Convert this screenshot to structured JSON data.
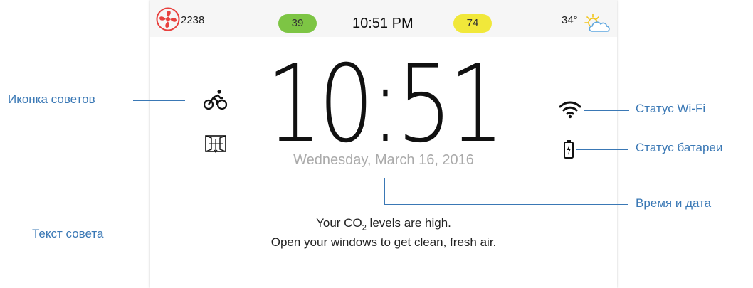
{
  "statusbar": {
    "fan_count": "2238",
    "green_badge": "39",
    "time": "10:51 PM",
    "yellow_badge": "74",
    "temperature": "34°",
    "icons": {
      "fan": "fan-icon",
      "weather": "partly-sunny-icon"
    },
    "colors": {
      "fan": "#e8413e",
      "green": "#7dc544",
      "yellow": "#f1e83a"
    }
  },
  "main": {
    "big_time": "10:51",
    "date": "Wednesday, March 16, 2016",
    "tip_icons": [
      "bicycle-icon",
      "window-icon"
    ],
    "status_icons": [
      "wifi-icon",
      "battery-icon"
    ],
    "tip_text": {
      "line1_prefix": "Your CO",
      "line1_sub": "2",
      "line1_suffix": " levels are high.",
      "line2": "Open your windows to get clean, fresh air."
    }
  },
  "annotations": {
    "tips_icon": "Иконка советов",
    "tip_text": "Текст совета",
    "wifi_status": "Статус Wi-Fi",
    "battery_status": "Статус батареи",
    "time_date": "Время и дата",
    "color": "#3a78b5"
  }
}
